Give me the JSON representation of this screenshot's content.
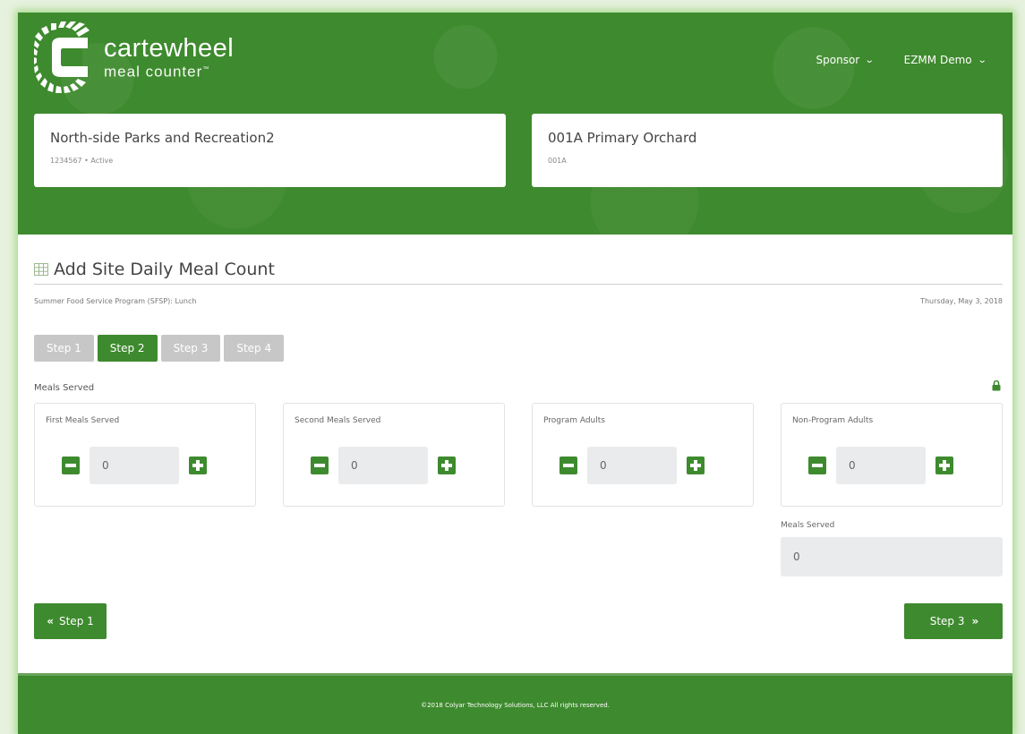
{
  "brand": {
    "name": "cartewheel",
    "subtitle": "meal counter",
    "trademark": "™",
    "accent_color": "#3e8a2e"
  },
  "top_nav": [
    {
      "label": "Sponsor",
      "icon": "chevron-down-icon"
    },
    {
      "label": "EZMM Demo",
      "icon": "chevron-down-icon"
    }
  ],
  "sponsor_card": {
    "title": "North-side Parks and Recreation2",
    "subtitle": "1234567 • Active"
  },
  "site_card": {
    "title": "001A Primary Orchard",
    "subtitle": "001A"
  },
  "page": {
    "title": "Add Site Daily Meal Count",
    "title_icon": "grid-icon",
    "program": "Summer Food Service Program (SFSP): Lunch",
    "date": "Thursday, May 3, 2018"
  },
  "steps": [
    {
      "label": "Step 1",
      "active": false
    },
    {
      "label": "Step 2",
      "active": true
    },
    {
      "label": "Step 3",
      "active": false
    },
    {
      "label": "Step 4",
      "active": false
    }
  ],
  "section_label": "Meals Served",
  "counters": [
    {
      "label": "First Meals Served",
      "value": "0"
    },
    {
      "label": "Second Meals Served",
      "value": "0"
    },
    {
      "label": "Program Adults",
      "value": "0"
    },
    {
      "label": "Non-Program Adults",
      "value": "0"
    }
  ],
  "total": {
    "label": "Meals Served",
    "value": "0"
  },
  "navigation": {
    "prev_label": "Step 1",
    "next_label": "Step 3"
  },
  "footer": {
    "text": "©2018 Colyar Technology Solutions, LLC All rights reserved."
  }
}
